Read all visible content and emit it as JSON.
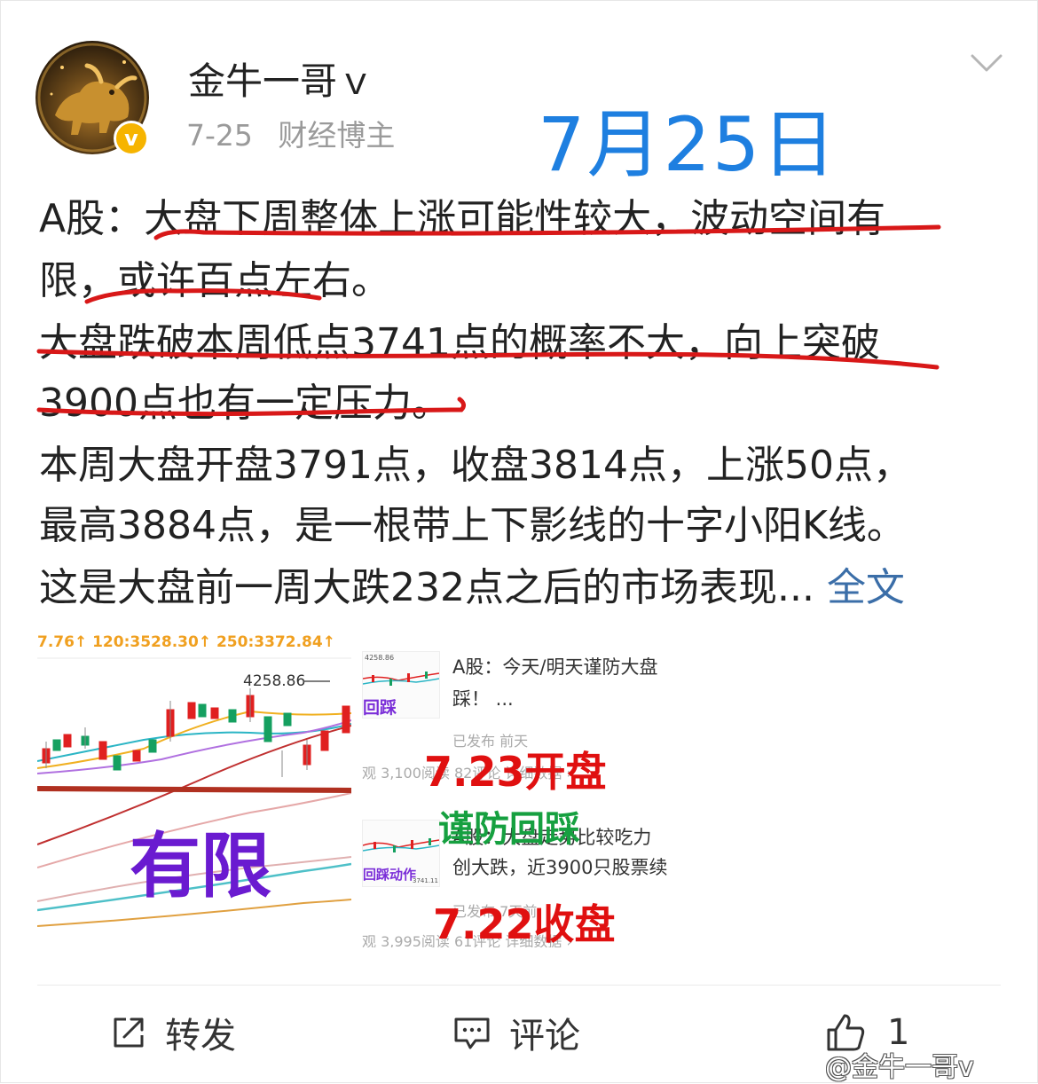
{
  "header": {
    "author_name": "金牛一哥ｖ",
    "post_date": "7-25",
    "author_tag": "财经博主",
    "verified_badge": "v",
    "annotation_date": "7月25日"
  },
  "post": {
    "lines": [
      "A股：大盘下周整体上涨可能性较大，波动空间有",
      "限，或许百点左右。",
      "大盘跌破本周低点3741点的概率不大，向上突破",
      "3900点也有一定压力。",
      "本周大盘开盘3791点，收盘3814点，上涨50点，",
      "最高3884点，是一根带上下影线的十字小阳K线。",
      "这是大盘前一周大跌232点之后的市场表现... "
    ],
    "more_link": "全文"
  },
  "attachment": {
    "chart_header": "7.76↑  120:3528.30↑  250:3372.84↑",
    "chart_peak_label": "4258.86",
    "chart_overlay_text": "有限",
    "thumb_labels": [
      "回踩",
      "回踩动作"
    ],
    "thumb_price_label": "3741.11",
    "item1": {
      "title_line1": "A股：今天/明天谨防大盘",
      "title_line2": "踩！ ...",
      "status": "已发布  前天",
      "stats": "观  3,100阅读  82评论  详细数据 ›"
    },
    "item2": {
      "title_line1": "A股：大盘走势比较吃力",
      "title_line2": "创大跌，近3900只股票续",
      "status": "已发布  7天前",
      "stats": "观  3,995阅读  61评论  详细数据 ›"
    },
    "note_red_1": "7.23开盘",
    "note_green": "谨防回踩",
    "note_red_2": "7.22收盘"
  },
  "actions": {
    "repost_label": "转发",
    "comment_label": "评论",
    "like_count": "1"
  },
  "watermark": "@金牛一哥v",
  "colors": {
    "accent_blue": "#1e7fe0",
    "annotation_red": "#e01010",
    "link_blue": "#3b6ea8",
    "badge_yellow": "#f6b400"
  }
}
